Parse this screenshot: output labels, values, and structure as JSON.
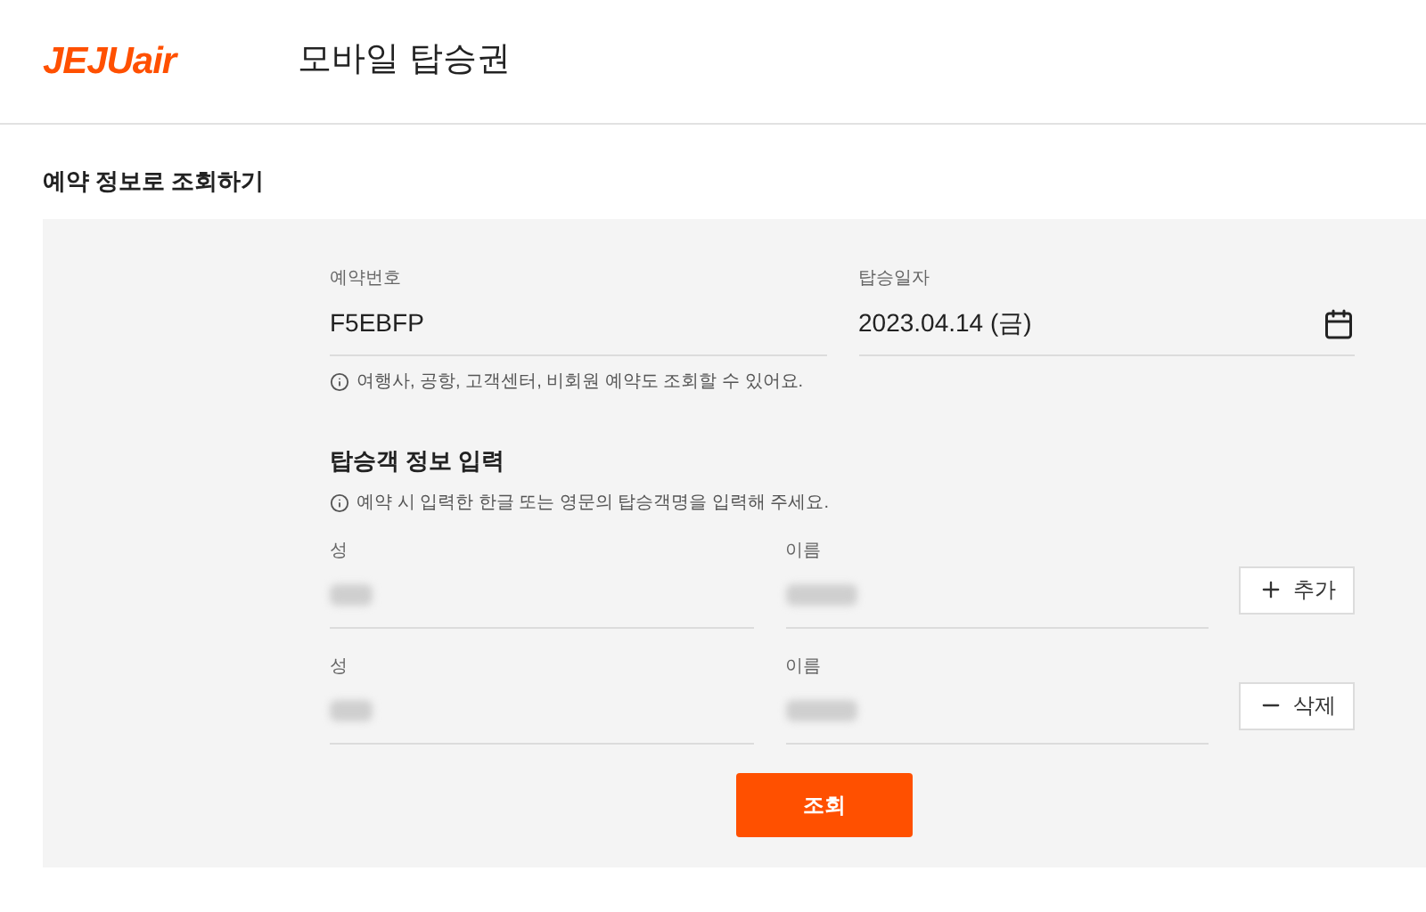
{
  "header": {
    "logo": "JEJUair",
    "title": "모바일 탑승권"
  },
  "section_title": "예약 정보로 조회하기",
  "booking": {
    "number": {
      "label": "예약번호",
      "value": "F5EBFP"
    },
    "date": {
      "label": "탑승일자",
      "value": "2023.04.14 (금)"
    },
    "hint": "여행사, 공항, 고객센터, 비회원 예약도 조회할 수 있어요."
  },
  "passenger_section": {
    "title": "탑승객 정보 입력",
    "hint": "예약 시 입력한 한글 또는 영문의 탑승객명을 입력해 주세요."
  },
  "passengers": [
    {
      "surname": {
        "label": "성",
        "blurred": true
      },
      "given_name": {
        "label": "이름",
        "blurred": true
      },
      "action": {
        "kind": "add",
        "label": "추가"
      }
    },
    {
      "surname": {
        "label": "성",
        "blurred": true
      },
      "given_name": {
        "label": "이름",
        "blurred": true
      },
      "action": {
        "kind": "remove",
        "label": "삭제"
      }
    }
  ],
  "submit": "조회"
}
